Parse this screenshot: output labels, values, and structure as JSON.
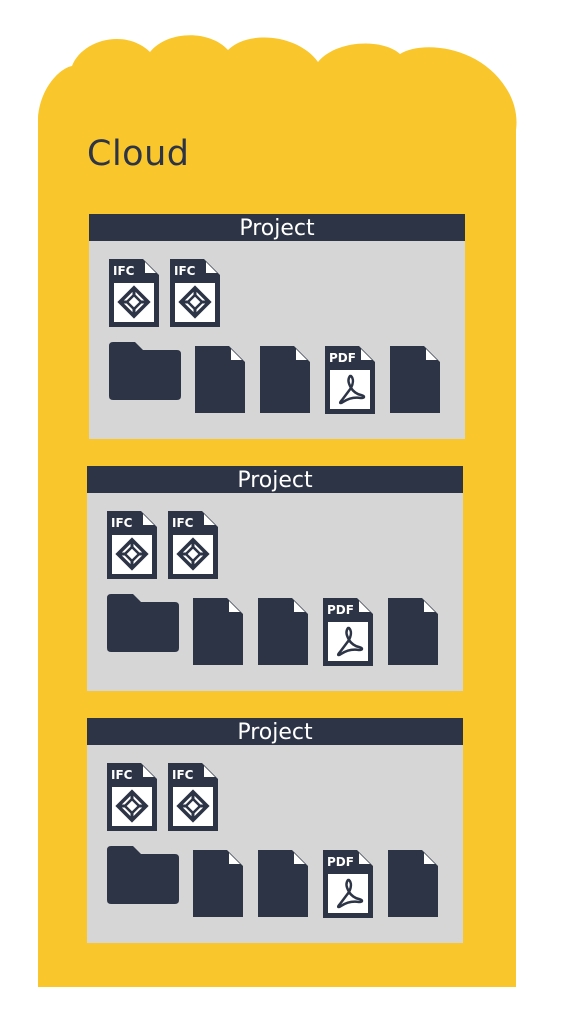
{
  "cloud": {
    "title": "Cloud",
    "fill_color": "#f9c62b"
  },
  "colors": {
    "panel": "#d6d6d6",
    "dark": "#2d3446",
    "white": "#ffffff"
  },
  "projects": [
    {
      "title": "Project",
      "ifc_files": [
        {
          "label": "IFC",
          "icon": "ifc-file-icon"
        },
        {
          "label": "IFC",
          "icon": "ifc-file-icon"
        }
      ],
      "items": [
        {
          "type": "folder",
          "icon": "folder-icon"
        },
        {
          "type": "file",
          "icon": "file-icon"
        },
        {
          "type": "file",
          "icon": "file-icon"
        },
        {
          "type": "pdf",
          "label": "PDF",
          "icon": "pdf-file-icon"
        },
        {
          "type": "file",
          "icon": "file-icon"
        }
      ]
    },
    {
      "title": "Project",
      "ifc_files": [
        {
          "label": "IFC",
          "icon": "ifc-file-icon"
        },
        {
          "label": "IFC",
          "icon": "ifc-file-icon"
        }
      ],
      "items": [
        {
          "type": "folder",
          "icon": "folder-icon"
        },
        {
          "type": "file",
          "icon": "file-icon"
        },
        {
          "type": "file",
          "icon": "file-icon"
        },
        {
          "type": "pdf",
          "label": "PDF",
          "icon": "pdf-file-icon"
        },
        {
          "type": "file",
          "icon": "file-icon"
        }
      ]
    },
    {
      "title": "Project",
      "ifc_files": [
        {
          "label": "IFC",
          "icon": "ifc-file-icon"
        },
        {
          "label": "IFC",
          "icon": "ifc-file-icon"
        }
      ],
      "items": [
        {
          "type": "folder",
          "icon": "folder-icon"
        },
        {
          "type": "file",
          "icon": "file-icon"
        },
        {
          "type": "file",
          "icon": "file-icon"
        },
        {
          "type": "pdf",
          "label": "PDF",
          "icon": "pdf-file-icon"
        },
        {
          "type": "file",
          "icon": "file-icon"
        }
      ]
    }
  ]
}
